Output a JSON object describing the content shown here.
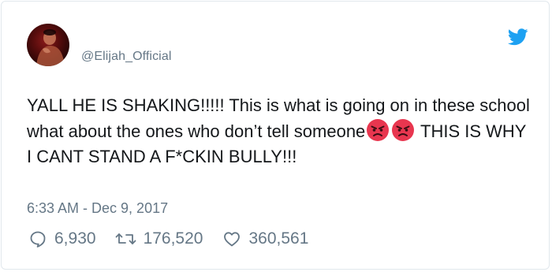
{
  "tweet": {
    "handle": "@Elijah_Official",
    "text_part1": "YALL HE IS SHAKING!!!!! This is what is going on in these school what about the ones who don’t tell someone",
    "emojis": [
      "angry-face-emoji",
      "angry-face-emoji"
    ],
    "text_part2": " THIS IS WHY I CANT STAND A F*CKIN BULLY!!!",
    "timestamp": "6:33 AM - Dec 9, 2017"
  },
  "stats": {
    "replies": "6,930",
    "retweets": "176,520",
    "likes": "360,561"
  },
  "icons": {
    "brand": "twitter-bird-icon",
    "reply": "reply-icon",
    "retweet": "retweet-icon",
    "like": "heart-icon"
  },
  "colors": {
    "brand": "#1da1f2",
    "secondary_text": "#657786",
    "primary_text": "#14171a",
    "emoji": "#e8364f",
    "border": "#e1e8ed"
  }
}
